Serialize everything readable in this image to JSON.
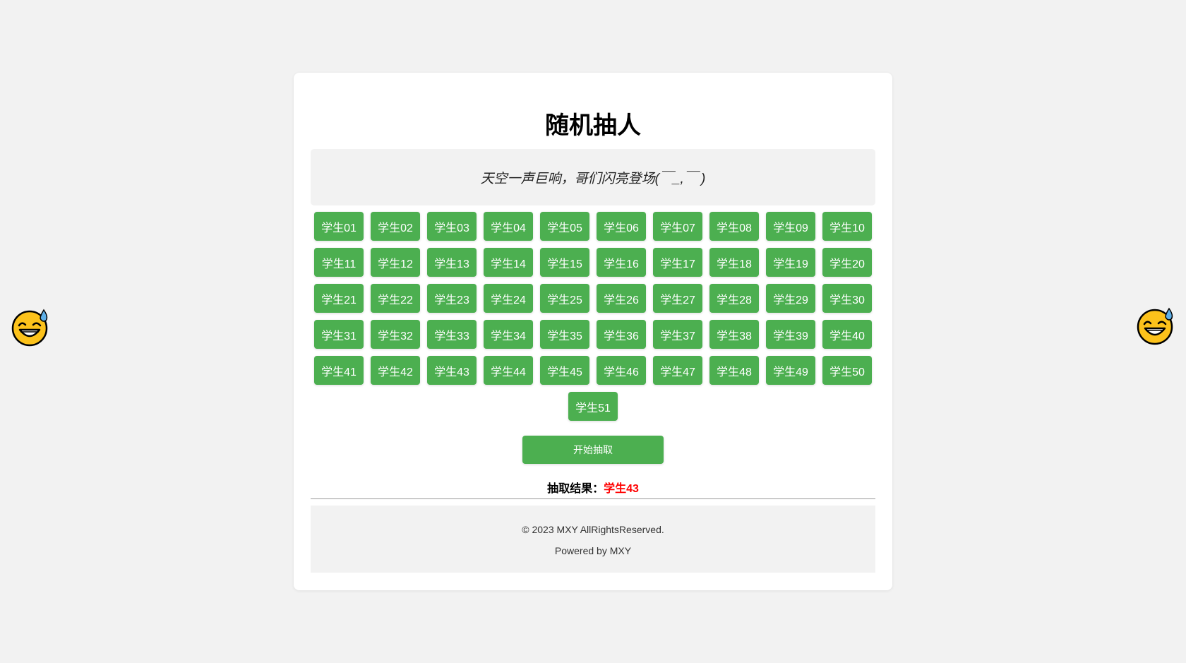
{
  "page": {
    "title": "随机抽人",
    "quote": "天空一声巨响，哥们闪亮登场(￣_,￣ )"
  },
  "students": [
    "学生01",
    "学生02",
    "学生03",
    "学生04",
    "学生05",
    "学生06",
    "学生07",
    "学生08",
    "学生09",
    "学生10",
    "学生11",
    "学生12",
    "学生13",
    "学生14",
    "学生15",
    "学生16",
    "学生17",
    "学生18",
    "学生19",
    "学生20",
    "学生21",
    "学生22",
    "学生23",
    "学生24",
    "学生25",
    "学生26",
    "学生27",
    "学生28",
    "学生29",
    "学生30",
    "学生31",
    "学生32",
    "学生33",
    "学生34",
    "学生35",
    "学生36",
    "学生37",
    "学生38",
    "学生39",
    "学生40",
    "学生41",
    "学生42",
    "学生43",
    "学生44",
    "学生45",
    "学生46",
    "学生47",
    "学生48",
    "学生49",
    "学生50",
    "学生51"
  ],
  "start_button": {
    "label": "开始抽取"
  },
  "result": {
    "label": "抽取结果：",
    "value": "学生43"
  },
  "footer": {
    "copyright": "© 2023 MXY AllRightsReserved.",
    "powered": "Powered by MXY"
  },
  "icons": {
    "left_emoji": "grinning-sweat-icon",
    "right_emoji": "grinning-sweat-icon"
  },
  "colors": {
    "accent": "#4caf50",
    "result": "#ff0000",
    "background": "#f2f2f2"
  }
}
